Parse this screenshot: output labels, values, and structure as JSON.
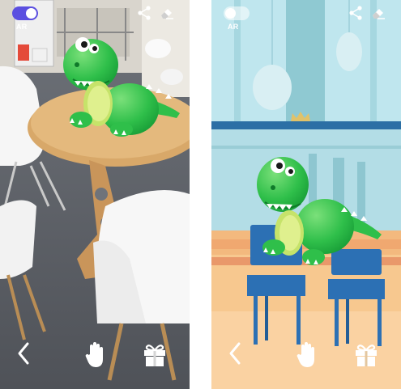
{
  "screens": [
    {
      "id": "ar",
      "toggle": {
        "label": "AR",
        "state": "on"
      },
      "icons": [
        "share-icon",
        "eraser-icon",
        "back-icon",
        "hand-icon",
        "gift-icon"
      ],
      "colors": {
        "toggle_on": "#5b4fe0",
        "dino_green": "#2fbf4a",
        "belly": "#c6e36a"
      }
    },
    {
      "id": "scene",
      "toggle": {
        "label": "AR",
        "state": "off"
      },
      "icons": [
        "share-icon",
        "eraser-icon",
        "back-icon",
        "hand-icon",
        "gift-icon"
      ],
      "colors": {
        "wall": "#bfe6ee",
        "floor": "#f7c88f",
        "chair": "#2c70b4"
      }
    }
  ]
}
